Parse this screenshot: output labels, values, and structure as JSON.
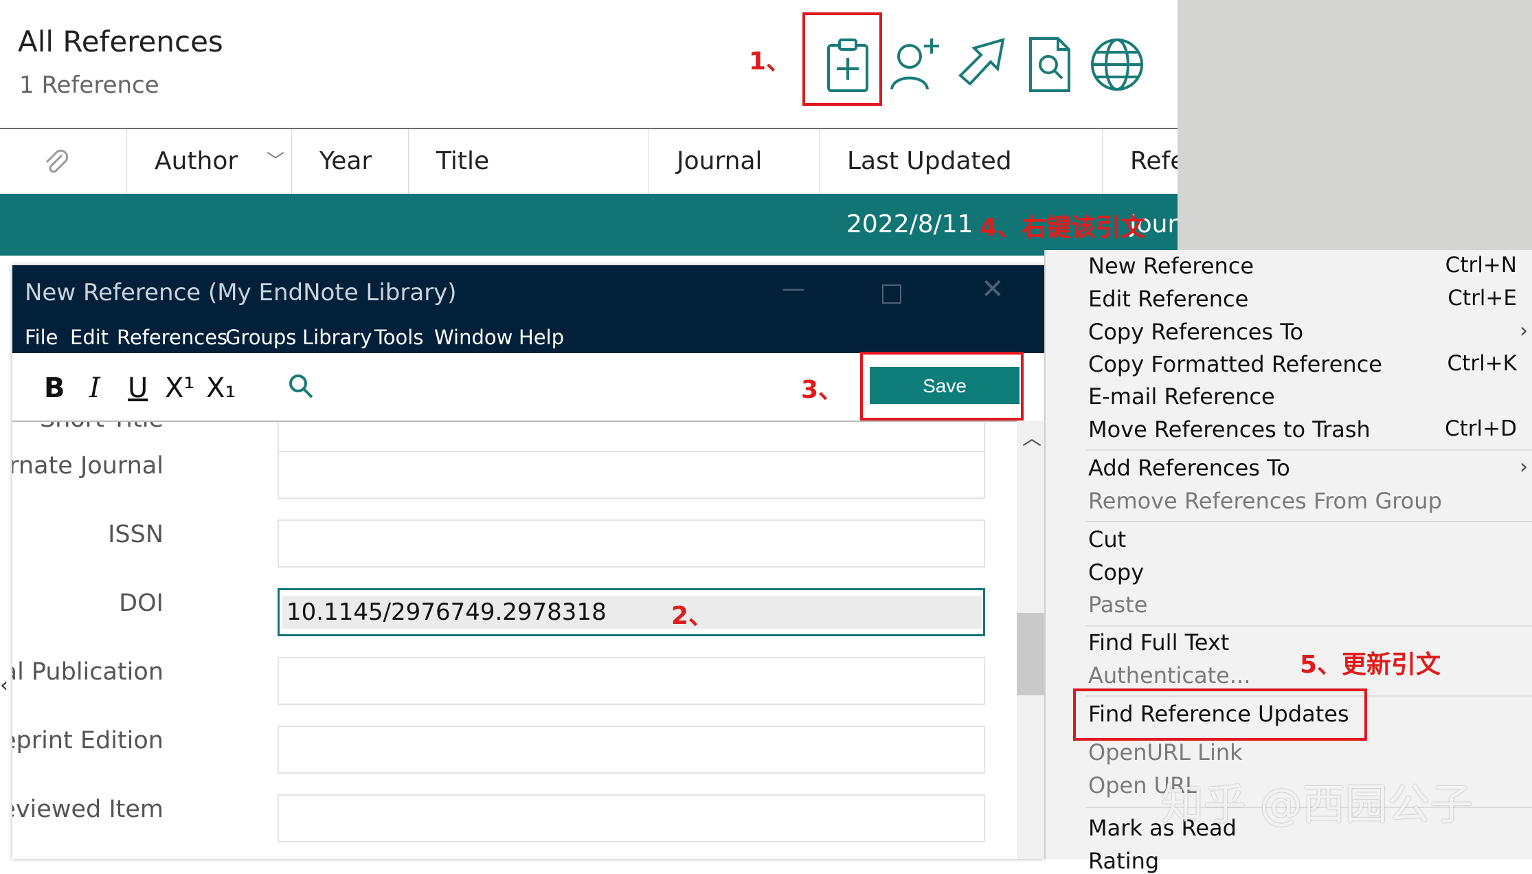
{
  "library": {
    "title": "All References",
    "count": "1 Reference",
    "columns": [
      "Author",
      "Year",
      "Title",
      "Journal",
      "Last Updated",
      "Refe"
    ],
    "row_updated": "2022/8/11",
    "row_type": "Jour"
  },
  "newref": {
    "window_title": "New Reference (My EndNote Library)",
    "menu": [
      "File",
      "Edit",
      "References",
      "Groups",
      "Library",
      "Tools",
      "Window",
      "Help"
    ],
    "format_buttons": [
      "B",
      "I",
      "U",
      "X¹",
      "X₁"
    ],
    "save_label": "Save",
    "fields": [
      {
        "label": "Short Title",
        "value": ""
      },
      {
        "label": "Alternate Journal",
        "value": ""
      },
      {
        "label": "ISSN",
        "value": ""
      },
      {
        "label": "DOI",
        "value": "10.1145/2976749.2978318"
      },
      {
        "label": "Original Publication",
        "value": ""
      },
      {
        "label": "Reprint Edition",
        "value": ""
      },
      {
        "label": "Reviewed Item",
        "value": ""
      }
    ]
  },
  "context_menu": {
    "items": [
      {
        "label": "New Reference",
        "shortcut": "Ctrl+N"
      },
      {
        "label": "Edit Reference",
        "shortcut": "Ctrl+E"
      },
      {
        "label": "Copy References To",
        "shortcut": ""
      },
      {
        "label": "Copy Formatted Reference",
        "shortcut": "Ctrl+K"
      },
      {
        "label": "E-mail Reference",
        "shortcut": ""
      },
      {
        "label": "Move References to Trash",
        "shortcut": "Ctrl+D"
      },
      {
        "label": "Add References To",
        "shortcut": ""
      },
      {
        "label": "Remove References From Group",
        "shortcut": ""
      },
      {
        "label": "Cut",
        "shortcut": ""
      },
      {
        "label": "Copy",
        "shortcut": ""
      },
      {
        "label": "Paste",
        "shortcut": ""
      },
      {
        "label": "Find Full Text",
        "shortcut": ""
      },
      {
        "label": "Authenticate...",
        "shortcut": ""
      },
      {
        "label": "Find Reference Updates",
        "shortcut": ""
      },
      {
        "label": "OpenURL Link",
        "shortcut": ""
      },
      {
        "label": "Open URL",
        "shortcut": ""
      },
      {
        "label": "Mark as Read",
        "shortcut": ""
      },
      {
        "label": "Rating",
        "shortcut": ""
      }
    ]
  },
  "annotations": {
    "step1": "1、",
    "step2": "2、",
    "step3": "3、",
    "step4": "4、右键该引文",
    "step5": "5、更新引文"
  },
  "watermark": "知乎 @西园公子",
  "colors": {
    "accent": "#127575",
    "titlebar": "#03203a",
    "annotation": "#e01b1b"
  }
}
